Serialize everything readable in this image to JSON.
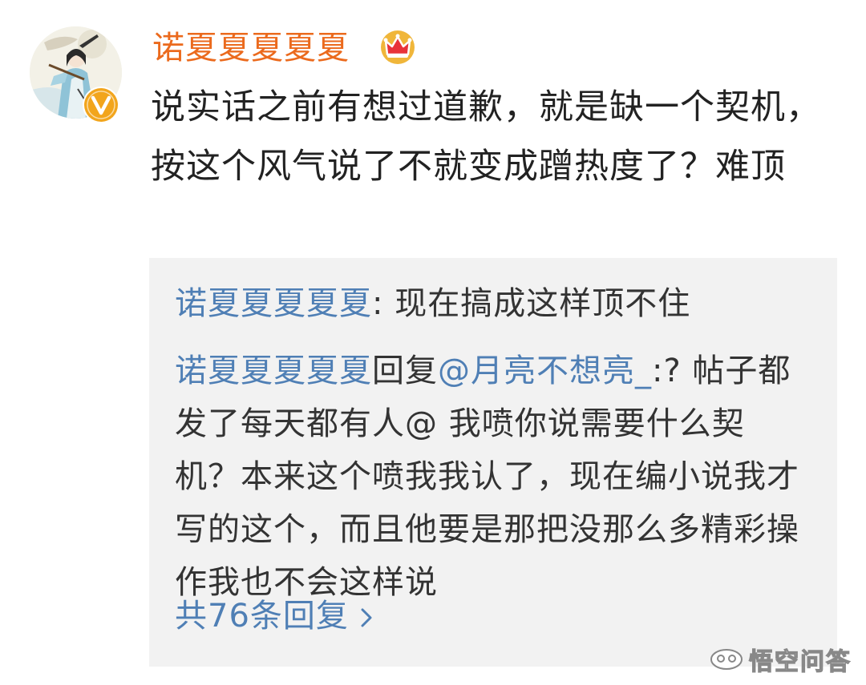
{
  "comment": {
    "username": "诺夏夏夏夏夏",
    "avatar_icon": "avatar-illustration",
    "badge_icon": "verified-v-icon",
    "vip_icon": "crown-icon",
    "text": "说实话之前有想过道歉，就是缺一个契机，按这个风气说了不就变成蹭热度了？难顶",
    "colors": {
      "username": "#eb6a1d",
      "link": "#4f7fb5",
      "reply_background": "#f2f2f2",
      "badge": "#f2a51c"
    }
  },
  "replies": [
    {
      "author": "诺夏夏夏夏夏",
      "separator": ": ",
      "text": "现在搞成这样顶不住"
    },
    {
      "author": "诺夏夏夏夏夏",
      "action": "回复",
      "mention": "@月亮不想亮_",
      "separator": ":",
      "text": "? 帖子都发了每天都有人@ 我喷你说需要什么契机？本来这个喷我我认了，现在编小说我才写的这个，而且他要是那把没那么多精彩操作我也不会这样说"
    }
  ],
  "total_replies": "共76条回复",
  "total_replies_icon": "chevron-right-icon",
  "watermark": {
    "icon": "wukong-logo-icon",
    "text": "悟空问答"
  }
}
